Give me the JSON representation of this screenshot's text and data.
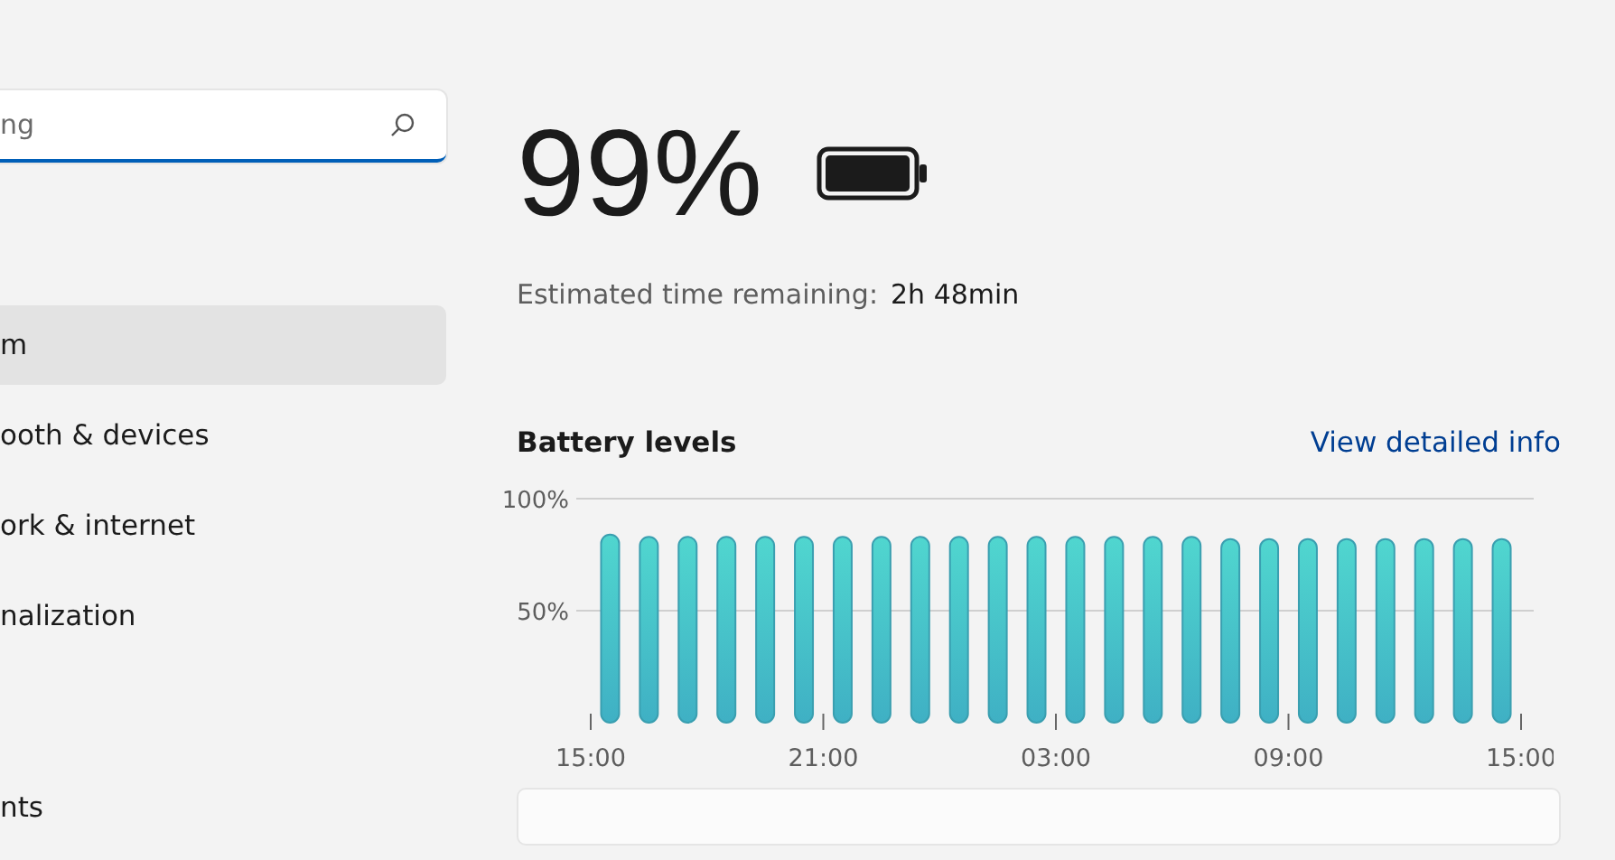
{
  "search": {
    "placeholder": "ng"
  },
  "sidebar": {
    "items": [
      {
        "label": "m",
        "selected": true
      },
      {
        "label": "ooth & devices",
        "selected": false
      },
      {
        "label": "ork & internet",
        "selected": false
      },
      {
        "label": "nalization",
        "selected": false
      },
      {
        "label": "nts",
        "selected": false
      }
    ]
  },
  "battery": {
    "percent": "99%",
    "level": 0.99,
    "estimate_label": "Estimated time remaining:",
    "estimate_value": "2h 48min"
  },
  "battery_levels": {
    "title": "Battery levels",
    "link": "View detailed info",
    "chart_data": {
      "type": "bar",
      "categories": [
        "15:00",
        null,
        null,
        null,
        null,
        null,
        "21:00",
        null,
        null,
        null,
        null,
        null,
        "03:00",
        null,
        null,
        null,
        null,
        null,
        "09:00",
        null,
        null,
        null,
        null,
        null,
        "15:00"
      ],
      "values": [
        84,
        83,
        83,
        83,
        83,
        83,
        83,
        83,
        83,
        83,
        83,
        83,
        83,
        83,
        83,
        83,
        82,
        82,
        82,
        82,
        82,
        82,
        82,
        82,
        null
      ],
      "ylim": [
        0,
        100
      ],
      "yticks": [
        {
          "value": 50,
          "label": "50%"
        },
        {
          "value": 100,
          "label": "100%"
        }
      ]
    }
  }
}
